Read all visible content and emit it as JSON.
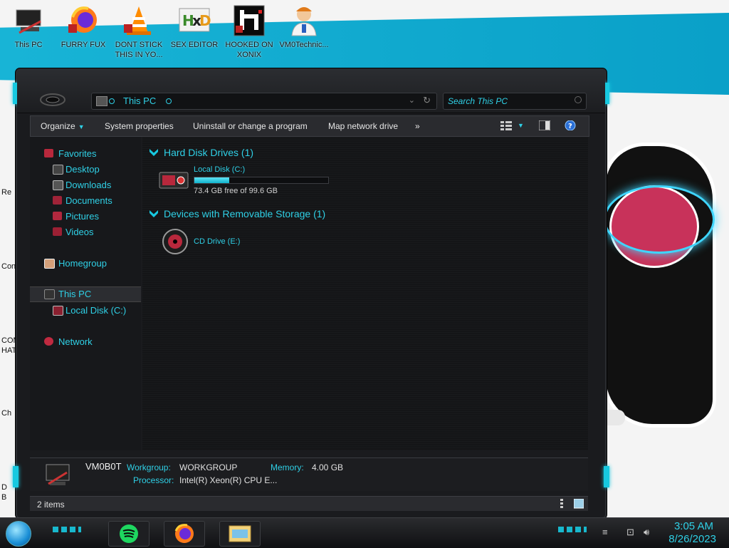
{
  "desktop": {
    "icons": [
      {
        "label": "This PC"
      },
      {
        "label": "FURRY FUX"
      },
      {
        "label": "DONT STICK THIS IN YO..."
      },
      {
        "label": "SEX EDITOR"
      },
      {
        "label": "HOOKED ON XONIX"
      },
      {
        "label": "VM0Technic..."
      }
    ],
    "side_labels": [
      "Re",
      "Con",
      "COM",
      "HATI",
      "Ch",
      "D",
      "B"
    ]
  },
  "window": {
    "address": {
      "path": "This PC"
    },
    "search": {
      "placeholder": "Search This PC"
    },
    "toolbar": {
      "organize": "Organize",
      "system_properties": "System properties",
      "uninstall": "Uninstall or change a program",
      "map_network": "Map network drive",
      "more": "»"
    },
    "nav": {
      "favorites": "Favorites",
      "desktop": "Desktop",
      "downloads": "Downloads",
      "documents": "Documents",
      "pictures": "Pictures",
      "videos": "Videos",
      "homegroup": "Homegroup",
      "this_pc": "This PC",
      "local_disk": "Local Disk (C:)",
      "network": "Network"
    },
    "groups": {
      "hard_disk": "Hard Disk Drives (1)",
      "removable": "Devices with Removable Storage (1)"
    },
    "drives": {
      "c": {
        "name": "Local Disk (C:)",
        "free_text": "73.4 GB free of 99.6 GB",
        "used_fraction": 0.263
      },
      "e": {
        "name": "CD Drive (E:)"
      }
    },
    "details": {
      "computer_name": "VM0B0T",
      "workgroup_label": "Workgroup:",
      "workgroup_value": "WORKGROUP",
      "memory_label": "Memory:",
      "memory_value": "4.00 GB",
      "processor_label": "Processor:",
      "processor_value": "Intel(R) Xeon(R) CPU E..."
    },
    "status": {
      "items": "2 items"
    }
  },
  "taskbar": {
    "time": "3:05 AM",
    "date": "8/26/2023"
  },
  "colors": {
    "accent": "#2fd0e6",
    "window_bg": "#1a1b1e",
    "wallpaper_cyan": "#0fb0d8"
  }
}
